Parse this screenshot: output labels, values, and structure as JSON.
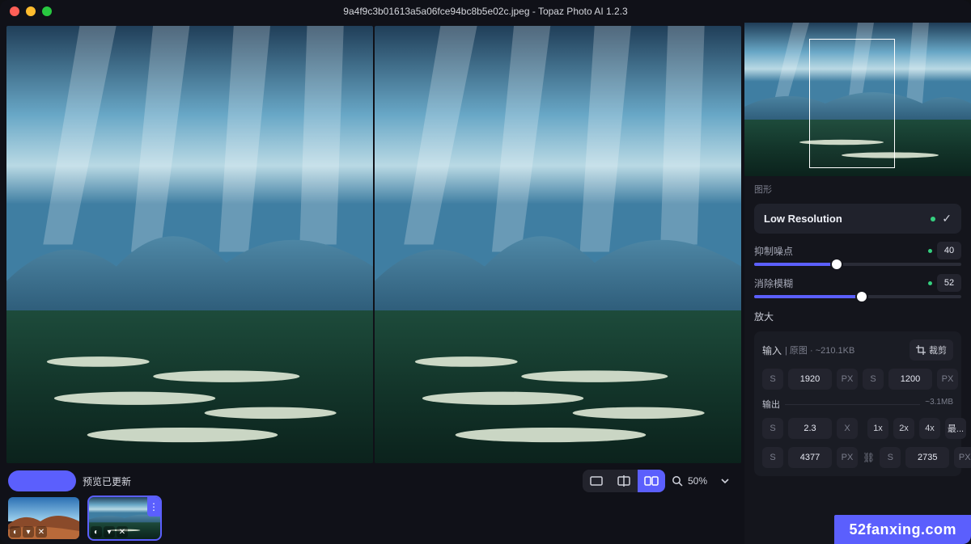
{
  "window": {
    "title": "9a4f9c3b01613a5a06fce94bc8b5e02c.jpeg - Topaz Photo AI 1.2.3"
  },
  "status": {
    "preview_updated": "预览已更新"
  },
  "zoom": {
    "level": "50%"
  },
  "model": {
    "name": "Low Resolution"
  },
  "sliders": {
    "noise": {
      "label": "抑制噪点",
      "value": 40,
      "pct": 40
    },
    "deblur": {
      "label": "消除模糊",
      "value": 52,
      "pct": 52
    }
  },
  "sections": {
    "enlarge": "放大",
    "input": "输入",
    "output": "输出"
  },
  "input": {
    "meta": "| 原图 · ~210.1KB",
    "crop": "裁剪",
    "s": "S",
    "w": "1920",
    "h": "1200",
    "px": "PX"
  },
  "output": {
    "size": "~3.1MB",
    "s": "S",
    "scale_value": "2.3",
    "x": "X",
    "presets": {
      "1x": "1x",
      "2x": "2x",
      "4x": "4x",
      "max": "最..."
    },
    "w": "4377",
    "h": "2735",
    "px": "PX"
  },
  "watermark": "52fanxing.com"
}
